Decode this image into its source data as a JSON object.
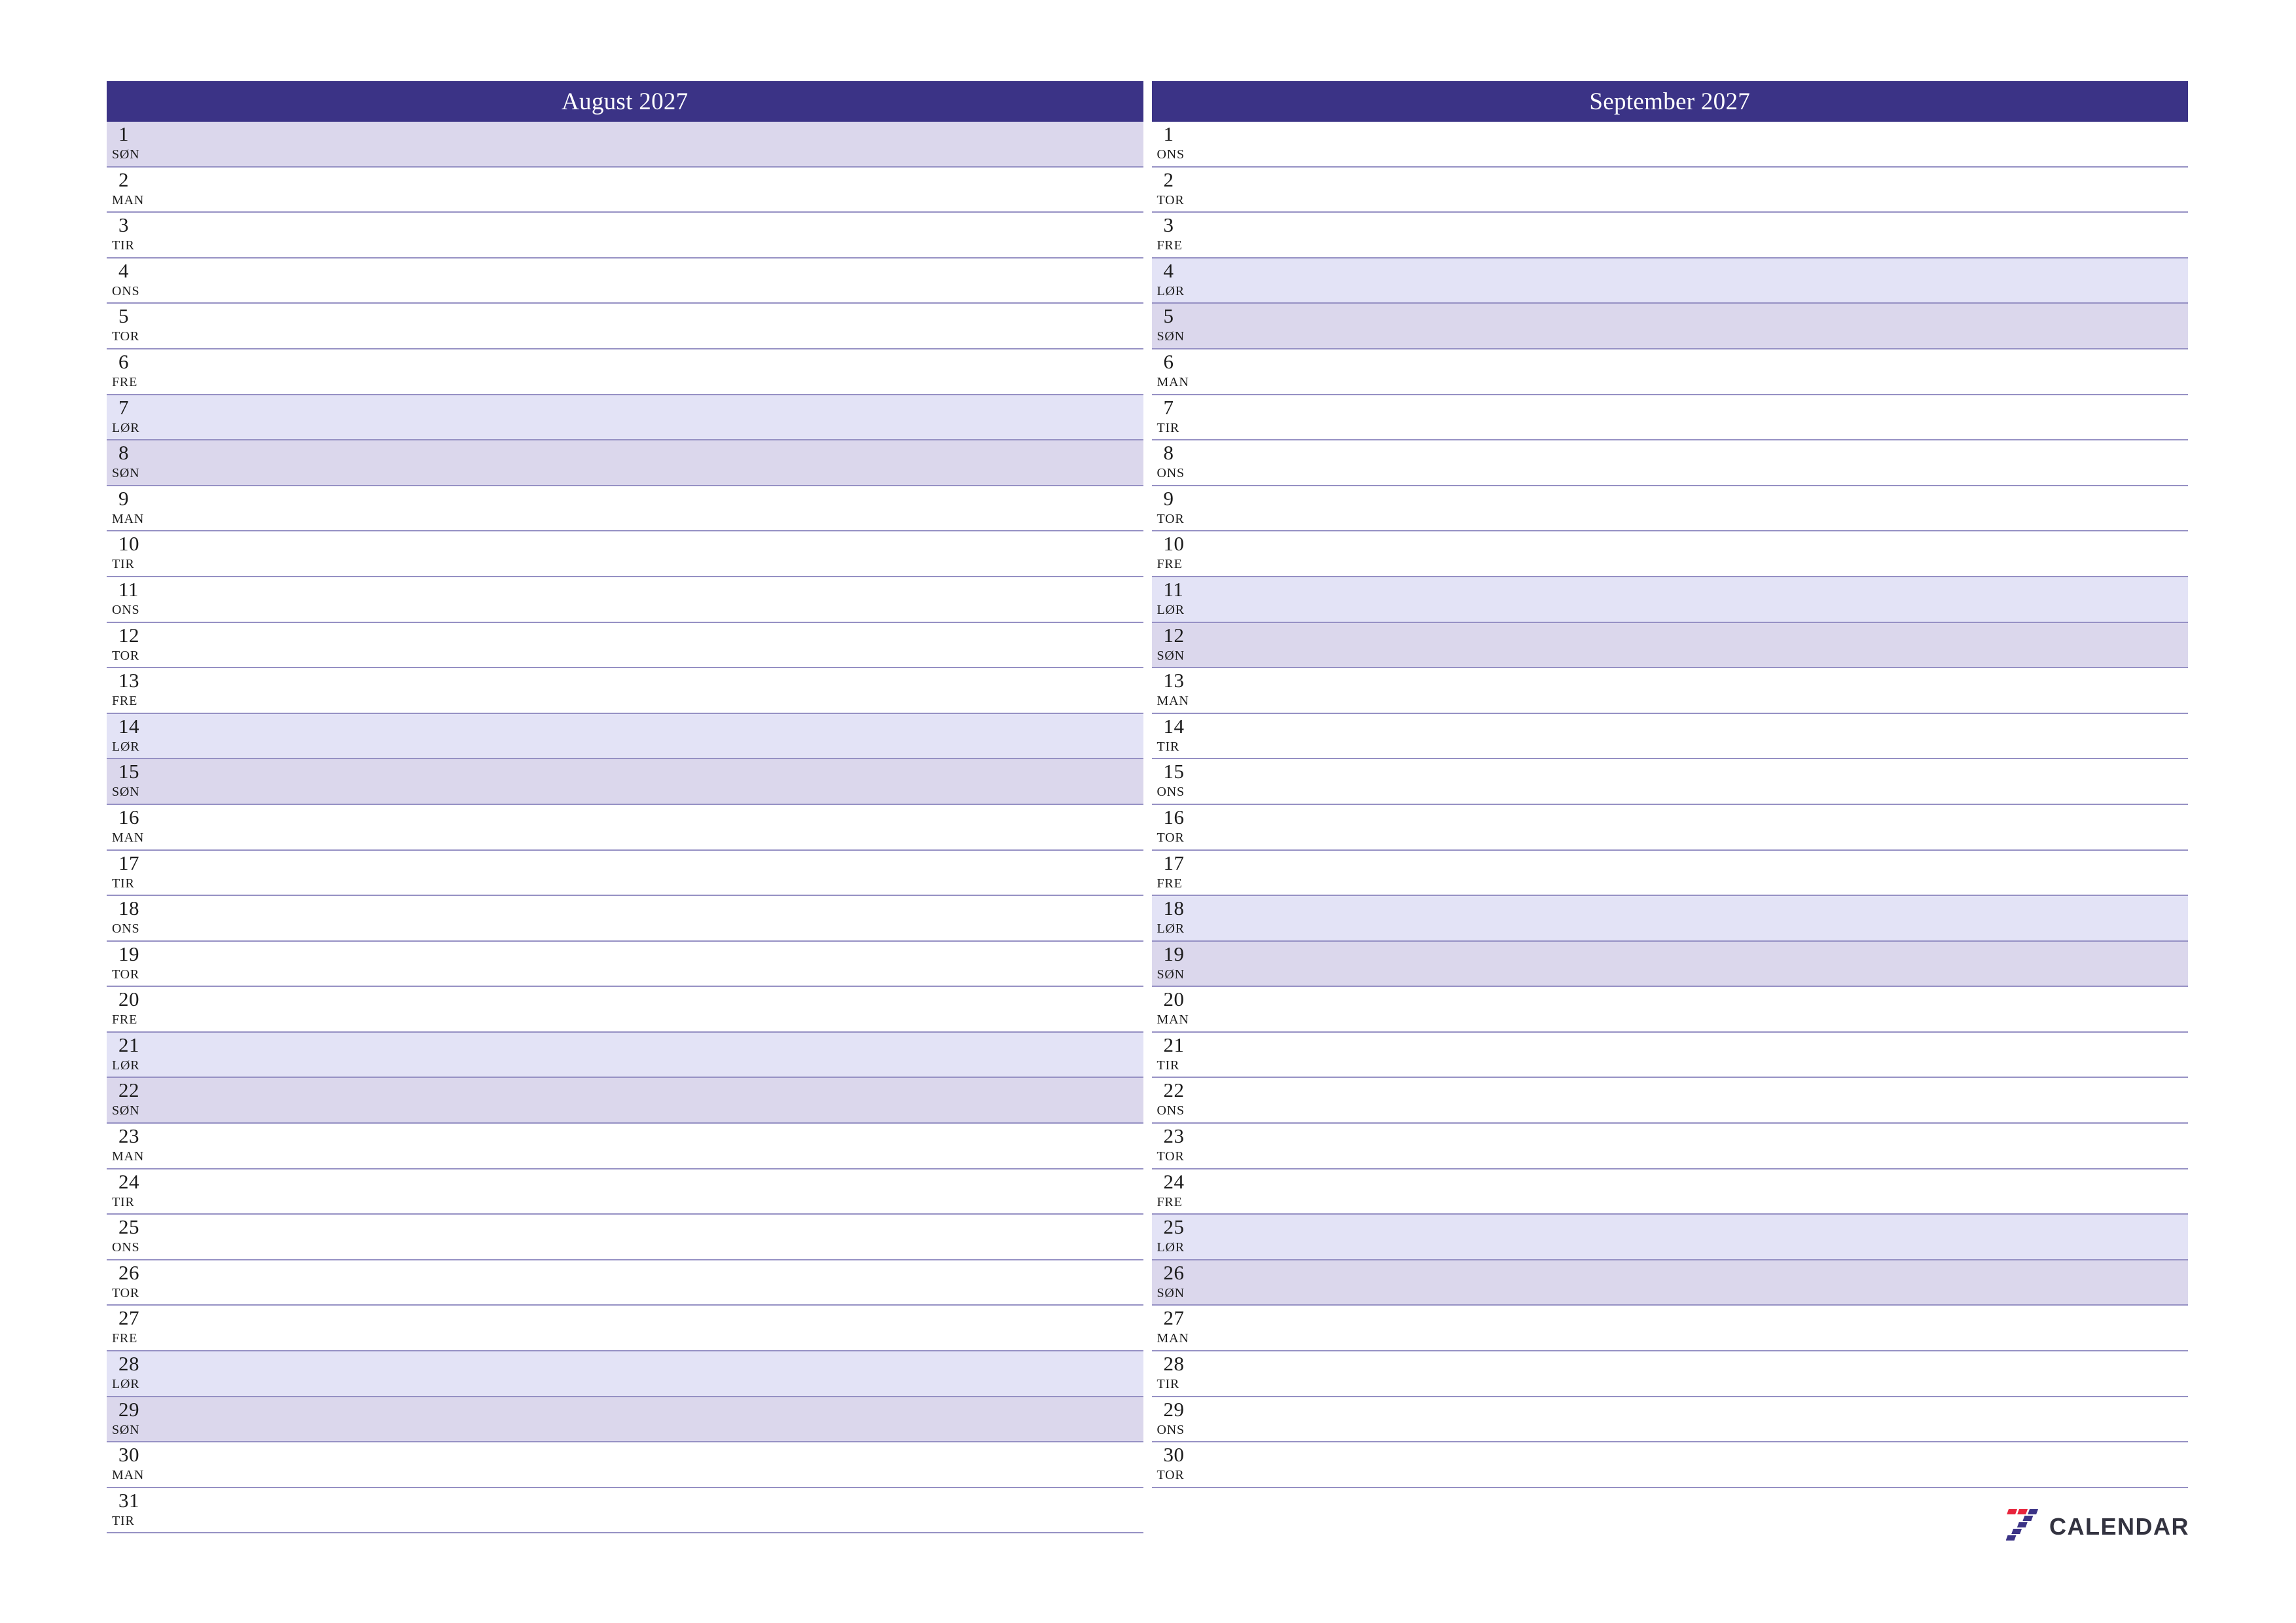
{
  "theme": {
    "header_bg": "#3b3386",
    "header_text": "#ffffff",
    "row_border": "#9691c4",
    "saturday_bg": "#e3e3f6",
    "sunday_bg": "#dbd7ec",
    "day_text": "#1c1c1c",
    "logo_word_color": "#333340",
    "logo_blue": "#3b3386",
    "logo_red": "#e8243c"
  },
  "months": [
    {
      "title": "August 2027",
      "days": [
        {
          "num": "1",
          "abbr": "SØN",
          "kind": "sun"
        },
        {
          "num": "2",
          "abbr": "MAN",
          "kind": "weekday"
        },
        {
          "num": "3",
          "abbr": "TIR",
          "kind": "weekday"
        },
        {
          "num": "4",
          "abbr": "ONS",
          "kind": "weekday"
        },
        {
          "num": "5",
          "abbr": "TOR",
          "kind": "weekday"
        },
        {
          "num": "6",
          "abbr": "FRE",
          "kind": "weekday"
        },
        {
          "num": "7",
          "abbr": "LØR",
          "kind": "sat"
        },
        {
          "num": "8",
          "abbr": "SØN",
          "kind": "sun"
        },
        {
          "num": "9",
          "abbr": "MAN",
          "kind": "weekday"
        },
        {
          "num": "10",
          "abbr": "TIR",
          "kind": "weekday"
        },
        {
          "num": "11",
          "abbr": "ONS",
          "kind": "weekday"
        },
        {
          "num": "12",
          "abbr": "TOR",
          "kind": "weekday"
        },
        {
          "num": "13",
          "abbr": "FRE",
          "kind": "weekday"
        },
        {
          "num": "14",
          "abbr": "LØR",
          "kind": "sat"
        },
        {
          "num": "15",
          "abbr": "SØN",
          "kind": "sun"
        },
        {
          "num": "16",
          "abbr": "MAN",
          "kind": "weekday"
        },
        {
          "num": "17",
          "abbr": "TIR",
          "kind": "weekday"
        },
        {
          "num": "18",
          "abbr": "ONS",
          "kind": "weekday"
        },
        {
          "num": "19",
          "abbr": "TOR",
          "kind": "weekday"
        },
        {
          "num": "20",
          "abbr": "FRE",
          "kind": "weekday"
        },
        {
          "num": "21",
          "abbr": "LØR",
          "kind": "sat"
        },
        {
          "num": "22",
          "abbr": "SØN",
          "kind": "sun"
        },
        {
          "num": "23",
          "abbr": "MAN",
          "kind": "weekday"
        },
        {
          "num": "24",
          "abbr": "TIR",
          "kind": "weekday"
        },
        {
          "num": "25",
          "abbr": "ONS",
          "kind": "weekday"
        },
        {
          "num": "26",
          "abbr": "TOR",
          "kind": "weekday"
        },
        {
          "num": "27",
          "abbr": "FRE",
          "kind": "weekday"
        },
        {
          "num": "28",
          "abbr": "LØR",
          "kind": "sat"
        },
        {
          "num": "29",
          "abbr": "SØN",
          "kind": "sun"
        },
        {
          "num": "30",
          "abbr": "MAN",
          "kind": "weekday"
        },
        {
          "num": "31",
          "abbr": "TIR",
          "kind": "weekday"
        }
      ]
    },
    {
      "title": "September 2027",
      "days": [
        {
          "num": "1",
          "abbr": "ONS",
          "kind": "weekday"
        },
        {
          "num": "2",
          "abbr": "TOR",
          "kind": "weekday"
        },
        {
          "num": "3",
          "abbr": "FRE",
          "kind": "weekday"
        },
        {
          "num": "4",
          "abbr": "LØR",
          "kind": "sat"
        },
        {
          "num": "5",
          "abbr": "SØN",
          "kind": "sun"
        },
        {
          "num": "6",
          "abbr": "MAN",
          "kind": "weekday"
        },
        {
          "num": "7",
          "abbr": "TIR",
          "kind": "weekday"
        },
        {
          "num": "8",
          "abbr": "ONS",
          "kind": "weekday"
        },
        {
          "num": "9",
          "abbr": "TOR",
          "kind": "weekday"
        },
        {
          "num": "10",
          "abbr": "FRE",
          "kind": "weekday"
        },
        {
          "num": "11",
          "abbr": "LØR",
          "kind": "sat"
        },
        {
          "num": "12",
          "abbr": "SØN",
          "kind": "sun"
        },
        {
          "num": "13",
          "abbr": "MAN",
          "kind": "weekday"
        },
        {
          "num": "14",
          "abbr": "TIR",
          "kind": "weekday"
        },
        {
          "num": "15",
          "abbr": "ONS",
          "kind": "weekday"
        },
        {
          "num": "16",
          "abbr": "TOR",
          "kind": "weekday"
        },
        {
          "num": "17",
          "abbr": "FRE",
          "kind": "weekday"
        },
        {
          "num": "18",
          "abbr": "LØR",
          "kind": "sat"
        },
        {
          "num": "19",
          "abbr": "SØN",
          "kind": "sun"
        },
        {
          "num": "20",
          "abbr": "MAN",
          "kind": "weekday"
        },
        {
          "num": "21",
          "abbr": "TIR",
          "kind": "weekday"
        },
        {
          "num": "22",
          "abbr": "ONS",
          "kind": "weekday"
        },
        {
          "num": "23",
          "abbr": "TOR",
          "kind": "weekday"
        },
        {
          "num": "24",
          "abbr": "FRE",
          "kind": "weekday"
        },
        {
          "num": "25",
          "abbr": "LØR",
          "kind": "sat"
        },
        {
          "num": "26",
          "abbr": "SØN",
          "kind": "sun"
        },
        {
          "num": "27",
          "abbr": "MAN",
          "kind": "weekday"
        },
        {
          "num": "28",
          "abbr": "TIR",
          "kind": "weekday"
        },
        {
          "num": "29",
          "abbr": "ONS",
          "kind": "weekday"
        },
        {
          "num": "30",
          "abbr": "TOR",
          "kind": "weekday"
        }
      ]
    }
  ],
  "logo": {
    "mark": "seven-logo-icon",
    "word": "CALENDAR"
  }
}
